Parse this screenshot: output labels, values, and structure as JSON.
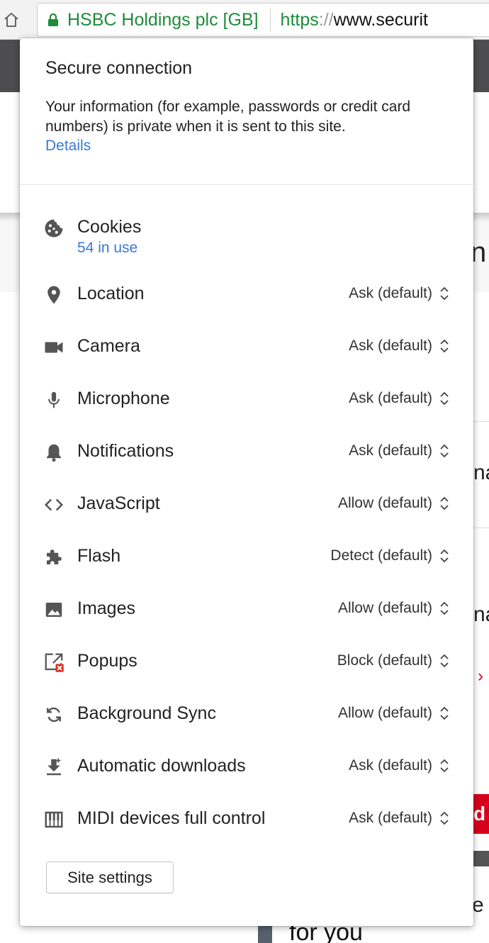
{
  "browser": {
    "ev_name": "HSBC Holdings plc [GB]",
    "url_scheme": "https",
    "url_separator": "://",
    "url_host": "www.securit"
  },
  "background_page": {
    "frag_1": "n",
    "frag_2": "na",
    "frag_3": "na",
    "frag_4": "›",
    "frag_5": "d l",
    "frag_6": "e",
    "bottom_text": "for you"
  },
  "popup": {
    "title": "Secure connection",
    "description": "Your information (for example, passwords or credit card numbers) is private when it is sent to this site.",
    "details_link": "Details",
    "cookies": {
      "label": "Cookies",
      "in_use": "54 in use"
    },
    "permissions": [
      {
        "label": "Location",
        "value": "Ask (default)",
        "icon": "location-pin-icon"
      },
      {
        "label": "Camera",
        "value": "Ask (default)",
        "icon": "camera-icon"
      },
      {
        "label": "Microphone",
        "value": "Ask (default)",
        "icon": "microphone-icon"
      },
      {
        "label": "Notifications",
        "value": "Ask (default)",
        "icon": "bell-icon"
      },
      {
        "label": "JavaScript",
        "value": "Allow (default)",
        "icon": "code-icon"
      },
      {
        "label": "Flash",
        "value": "Detect (default)",
        "icon": "puzzle-icon"
      },
      {
        "label": "Images",
        "value": "Allow (default)",
        "icon": "image-icon"
      },
      {
        "label": "Popups",
        "value": "Block (default)",
        "icon": "popup-blocked-icon"
      },
      {
        "label": "Background Sync",
        "value": "Allow (default)",
        "icon": "sync-icon"
      },
      {
        "label": "Automatic downloads",
        "value": "Ask (default)",
        "icon": "download-icon"
      },
      {
        "label": "MIDI devices full control",
        "value": "Ask (default)",
        "icon": "piano-keys-icon"
      }
    ],
    "site_settings_button": "Site settings"
  },
  "colors": {
    "link_blue": "#3b78d6",
    "secure_green": "#1e8c3a",
    "icon_gray": "#555555"
  }
}
